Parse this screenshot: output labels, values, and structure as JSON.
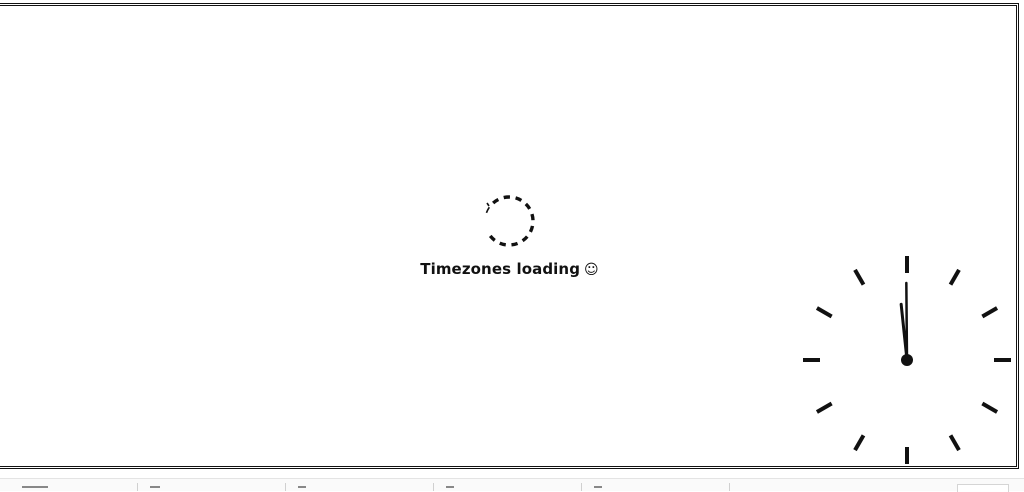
{
  "loading": {
    "message": "Timezones loading",
    "emoji": "☺"
  },
  "clock": {
    "hours": 11,
    "minutes": 59,
    "color": "#111111"
  },
  "icons": {
    "spinner": "dashed-circle-spinner-icon",
    "clock": "analog-clock-icon"
  }
}
